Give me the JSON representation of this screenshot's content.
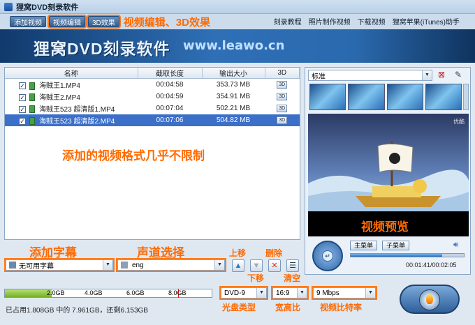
{
  "window": {
    "title": "狸窝DVD刻录软件"
  },
  "toolbar": {
    "buttons": [
      "添加视频",
      "视频编辑",
      "3D效果"
    ],
    "annotation": "视频编辑、3D效果",
    "links": [
      "刻录教程",
      "照片制作视频",
      "下载视频",
      "狸窝苹果(iTunes)助手"
    ]
  },
  "banner": {
    "title": "狸窝DVD刻录软件",
    "url": "www.leawo.cn"
  },
  "file_table": {
    "columns": [
      "名称",
      "截取长度",
      "输出大小",
      "3D"
    ],
    "rows": [
      {
        "name": "海贼王1.MP4",
        "duration": "00:04:58",
        "size": "353.73 MB",
        "d3": "3D"
      },
      {
        "name": "海贼王2.MP4",
        "duration": "00:04:59",
        "size": "354.91 MB",
        "d3": "3D"
      },
      {
        "name": "海贼王523 超清版1.MP4",
        "duration": "00:07:04",
        "size": "502.21 MB",
        "d3": "3D"
      },
      {
        "name": "海贼王523 超清版2.MP4",
        "duration": "00:07:06",
        "size": "504.82 MB",
        "d3": "3D"
      }
    ],
    "selected_row": 3,
    "annotation": "添加的视频格式几乎不限制"
  },
  "subtitle": {
    "annotation": "添加字幕",
    "value": "无可用字幕"
  },
  "audio": {
    "annotation": "声道选择",
    "value": "eng"
  },
  "list_actions": {
    "up": "上移",
    "down": "下移",
    "delete": "删除",
    "clear": "清空"
  },
  "preview": {
    "template_select": "标准",
    "annotation": "视频预览",
    "watermark": "优酷",
    "buttons": {
      "main_menu": "主菜单",
      "sub_menu": "子菜单"
    },
    "time": "00:01:41/00:02:05",
    "progress": 0.81
  },
  "disk": {
    "ticks": [
      "2.0GB",
      "4.0GB",
      "6.0GB",
      "8.0GB"
    ],
    "fill_fraction": 0.227,
    "status": "已占用1.808GB 中的 7.961GB，还剩6.153GB"
  },
  "output": {
    "disc_type": {
      "value": "DVD-9",
      "label": "光盘类型"
    },
    "aspect": {
      "value": "16:9",
      "label": "宽高比"
    },
    "bitrate": {
      "value": "9 Mbps",
      "label": "视频比特率"
    }
  },
  "colors": {
    "annotation": "#ff6a00",
    "selection": "#3b6fc8",
    "banner": "#2f6fb6"
  }
}
